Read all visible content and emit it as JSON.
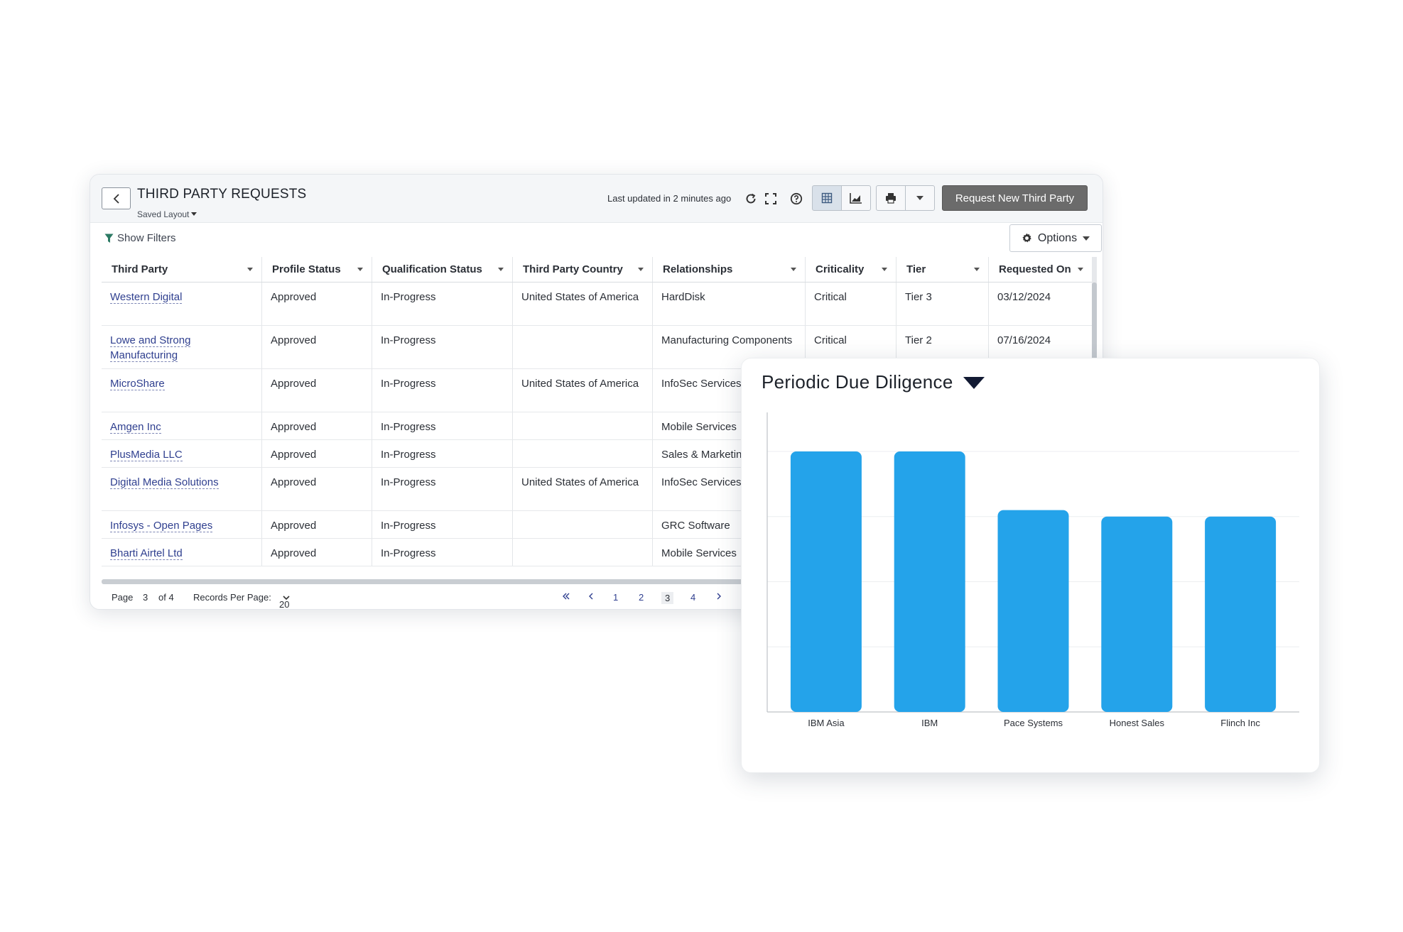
{
  "header": {
    "title": "THIRD PARTY REQUESTS",
    "saved_layout": "Saved Layout",
    "last_updated": "Last updated in 2 minutes ago",
    "request_button": "Request New Third Party"
  },
  "filters": {
    "show_filters": "Show Filters",
    "options": "Options"
  },
  "table": {
    "columns": [
      "Third Party",
      "Profile Status",
      "Qualification Status",
      "Third Party Country",
      "Relationships",
      "Criticality",
      "Tier",
      "Requested On"
    ],
    "rows": [
      {
        "third_party": "Western Digital",
        "profile_status": "Approved",
        "qualification_status": "In-Progress",
        "country": "United States of America",
        "relationships": "HardDisk",
        "criticality": "Critical",
        "tier": "Tier 3",
        "requested_on": "03/12/2024"
      },
      {
        "third_party": "Lowe and Strong Manufacturing",
        "profile_status": "Approved",
        "qualification_status": "In-Progress",
        "country": "",
        "relationships": "Manufacturing Components",
        "criticality": "Critical",
        "tier": "Tier 2",
        "requested_on": "07/16/2024"
      },
      {
        "third_party": "MicroShare",
        "profile_status": "Approved",
        "qualification_status": "In-Progress",
        "country": "United States of America",
        "relationships": "InfoSec Services",
        "criticality": "",
        "tier": "",
        "requested_on": ""
      },
      {
        "third_party": "Amgen Inc",
        "profile_status": "Approved",
        "qualification_status": "In-Progress",
        "country": "",
        "relationships": "Mobile Services",
        "criticality": "",
        "tier": "",
        "requested_on": ""
      },
      {
        "third_party": "PlusMedia LLC",
        "profile_status": "Approved",
        "qualification_status": "In-Progress",
        "country": "",
        "relationships": "Sales & Marketing",
        "criticality": "",
        "tier": "",
        "requested_on": ""
      },
      {
        "third_party": "Digital Media Solutions",
        "profile_status": "Approved",
        "qualification_status": "In-Progress",
        "country": "United States of America",
        "relationships": "InfoSec Services",
        "criticality": "",
        "tier": "",
        "requested_on": ""
      },
      {
        "third_party": "Infosys - Open Pages",
        "profile_status": "Approved",
        "qualification_status": "In-Progress",
        "country": "",
        "relationships": "GRC Software",
        "criticality": "",
        "tier": "",
        "requested_on": ""
      },
      {
        "third_party": "Bharti Airtel Ltd",
        "profile_status": "Approved",
        "qualification_status": "In-Progress",
        "country": "",
        "relationships": "Mobile Services",
        "criticality": "",
        "tier": "",
        "requested_on": ""
      }
    ]
  },
  "pagination": {
    "page_label": "Page",
    "current_page": "3",
    "of_label": "of 4",
    "records_label": "Records Per Page:",
    "records_value": "20",
    "pages": [
      "1",
      "2",
      "3",
      "4"
    ]
  },
  "chart_panel": {
    "title": "Periodic Due Diligence"
  },
  "chart_data": {
    "type": "bar",
    "title": "Periodic Due Diligence",
    "categories": [
      "IBM Asia",
      "IBM",
      "Pace Systems",
      "Honest Sales",
      "Flinch Inc"
    ],
    "values": [
      4,
      4,
      3.1,
      3,
      3
    ],
    "ylim": [
      0,
      4.6
    ],
    "grid": true,
    "color": "#24a3ea"
  }
}
